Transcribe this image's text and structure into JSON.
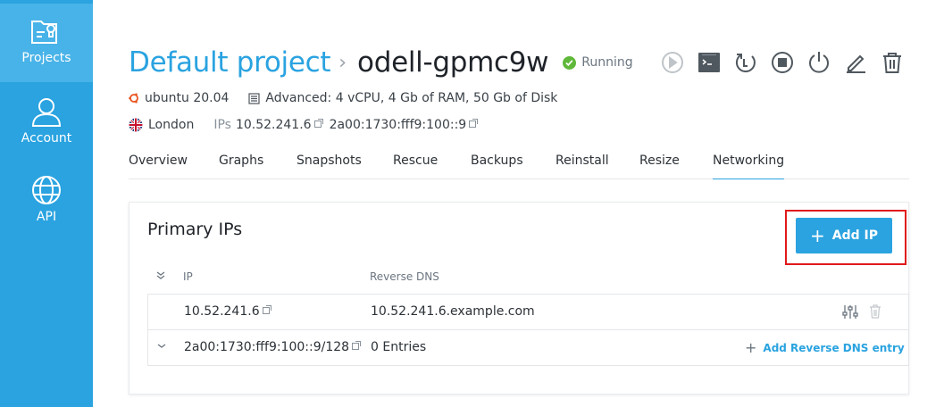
{
  "sidebar": {
    "items": [
      {
        "label": "Projects",
        "icon": "projects-icon",
        "active": true
      },
      {
        "label": "Account",
        "icon": "account-icon",
        "active": false
      },
      {
        "label": "API",
        "icon": "api-icon",
        "active": false
      }
    ]
  },
  "header": {
    "project": "Default project",
    "separator": "›",
    "server_name": "odell-gpmc9w",
    "status": "Running",
    "actions": [
      "play-icon",
      "console-icon",
      "rebuild-icon",
      "stop-icon",
      "power-icon",
      "edit-icon",
      "trash-icon"
    ]
  },
  "meta": {
    "os": "ubuntu 20.04",
    "plan": "Advanced: 4 vCPU, 4 Gb of RAM, 50 Gb of Disk",
    "location": "London",
    "ips_label": "IPs",
    "ipv4": "10.52.241.6",
    "ipv6": "2a00:1730:fff9:100::9"
  },
  "tabs": [
    {
      "label": "Overview",
      "active": false
    },
    {
      "label": "Graphs",
      "active": false
    },
    {
      "label": "Snapshots",
      "active": false
    },
    {
      "label": "Rescue",
      "active": false
    },
    {
      "label": "Backups",
      "active": false
    },
    {
      "label": "Reinstall",
      "active": false
    },
    {
      "label": "Resize",
      "active": false
    },
    {
      "label": "Networking",
      "active": true
    }
  ],
  "primary_ips": {
    "title": "Primary IPs",
    "add_button": "Add IP",
    "columns": {
      "ip": "IP",
      "reverse_dns": "Reverse DNS"
    },
    "rows": [
      {
        "ip": "10.52.241.6",
        "reverse_dns": "10.52.241.6.example.com"
      },
      {
        "ip": "2a00:1730:fff9:100::9/128",
        "reverse_dns": "0 Entries",
        "add_action": "Add Reverse DNS entry"
      }
    ]
  },
  "colors": {
    "accent": "#2aa3e0",
    "running": "#5fb83a",
    "highlight": "#e0191b"
  }
}
